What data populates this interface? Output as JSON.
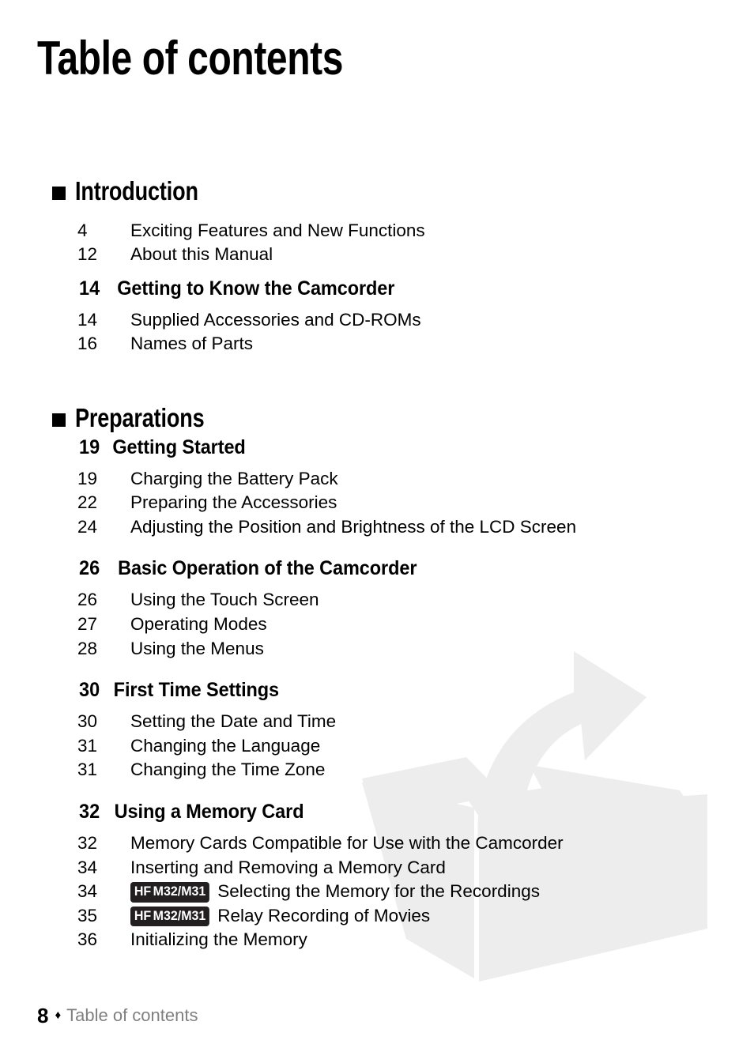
{
  "page": {
    "title": "Table of contents",
    "number": "8",
    "footer_separator": "♦",
    "footer_label": "Table of contents",
    "watermark": "open-box-with-arrow"
  },
  "colors": {
    "text": "#000000",
    "footer_label": "#808080",
    "badge_background": "#231f20",
    "badge_text": "#ffffff",
    "watermark": "#ededed",
    "page_background": "#ffffff"
  },
  "sections": [
    {
      "title": "Introduction",
      "bullet": "square-bullet",
      "entries": [
        {
          "page": "4",
          "label": "Exciting Features and New Functions",
          "bold": false,
          "badge": ""
        },
        {
          "page": "12",
          "label": "About this Manual",
          "bold": false,
          "badge": ""
        },
        {
          "page": "14",
          "label": "Getting to Know the Camcorder",
          "bold": true,
          "badge": ""
        },
        {
          "page": "14",
          "label": "Supplied Accessories and CD-ROMs",
          "bold": false,
          "badge": ""
        },
        {
          "page": "16",
          "label": "Names of Parts",
          "bold": false,
          "badge": ""
        }
      ]
    },
    {
      "title": "Preparations",
      "bullet": "square-bullet",
      "entries": [
        {
          "page": "19",
          "label": "Getting Started",
          "bold": true,
          "badge": ""
        },
        {
          "page": "19",
          "label": "Charging the Battery Pack",
          "bold": false,
          "badge": ""
        },
        {
          "page": "22",
          "label": "Preparing the Accessories",
          "bold": false,
          "badge": ""
        },
        {
          "page": "24",
          "label": "Adjusting the Position and Brightness of the LCD Screen",
          "bold": false,
          "badge": ""
        },
        {
          "page": "26",
          "label": "Basic Operation of the Camcorder",
          "bold": true,
          "badge": ""
        },
        {
          "page": "26",
          "label": "Using the Touch Screen",
          "bold": false,
          "badge": ""
        },
        {
          "page": "27",
          "label": "Operating Modes",
          "bold": false,
          "badge": ""
        },
        {
          "page": "28",
          "label": "Using the Menus",
          "bold": false,
          "badge": ""
        },
        {
          "page": "30",
          "label": "First Time Settings",
          "bold": true,
          "badge": ""
        },
        {
          "page": "30",
          "label": "Setting the Date and Time",
          "bold": false,
          "badge": ""
        },
        {
          "page": "31",
          "label": "Changing the Language",
          "bold": false,
          "badge": ""
        },
        {
          "page": "31",
          "label": "Changing the Time Zone",
          "bold": false,
          "badge": ""
        },
        {
          "page": "32",
          "label": "Using a Memory Card",
          "bold": true,
          "badge": ""
        },
        {
          "page": "32",
          "label": "Memory Cards Compatible for Use with the Camcorder",
          "bold": false,
          "badge": ""
        },
        {
          "page": "34",
          "label": "Inserting and Removing a Memory Card",
          "bold": false,
          "badge": ""
        },
        {
          "page": "34",
          "label": "Selecting the Memory for the Recordings",
          "bold": false,
          "badge": "HF M32/M31"
        },
        {
          "page": "35",
          "label": "Relay Recording of Movies",
          "bold": false,
          "badge": "HF M32/M31"
        },
        {
          "page": "36",
          "label": "Initializing the Memory",
          "bold": false,
          "badge": ""
        }
      ]
    }
  ]
}
